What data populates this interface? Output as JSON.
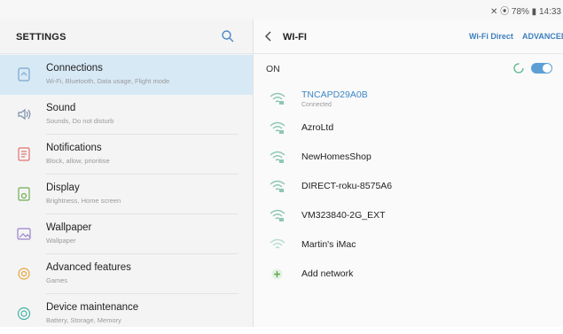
{
  "status_bar": {
    "text": "✕ ⦿ 78% ▮ 14:33"
  },
  "settings": {
    "title": "SETTINGS",
    "items": [
      {
        "label": "Connections",
        "sub": "Wi-Fi, Bluetooth, Data usage, Flight mode",
        "icon": "connections-icon",
        "active": true
      },
      {
        "label": "Sound",
        "sub": "Sounds, Do not disturb",
        "icon": "sound-icon"
      },
      {
        "label": "Notifications",
        "sub": "Block, allow, prioritise",
        "icon": "notifications-icon"
      },
      {
        "label": "Display",
        "sub": "Brightness, Home screen",
        "icon": "display-icon"
      },
      {
        "label": "Wallpaper",
        "sub": "Wallpaper",
        "icon": "wallpaper-icon"
      },
      {
        "label": "Advanced features",
        "sub": "Games",
        "icon": "advanced-features-icon"
      },
      {
        "label": "Device maintenance",
        "sub": "Battery, Storage, Memory",
        "icon": "device-maintenance-icon"
      }
    ]
  },
  "wifi": {
    "title": "WI-FI",
    "wifi_direct": "Wi-Fi Direct",
    "advanced": "ADVANCED",
    "on_label": "ON",
    "networks": [
      {
        "name": "TNCAPD29A0B",
        "status": "Connected"
      },
      {
        "name": "AzroLtd"
      },
      {
        "name": "NewHomesShop"
      },
      {
        "name": "DIRECT-roku-8575A6"
      },
      {
        "name": "VM323840-2G_EXT"
      },
      {
        "name": "Martin's iMac"
      }
    ],
    "add_network": "Add network"
  },
  "colors": {
    "accent": "#3d86c6",
    "active_bg": "#d7e9f5",
    "toggle": "#5b9fd6"
  }
}
